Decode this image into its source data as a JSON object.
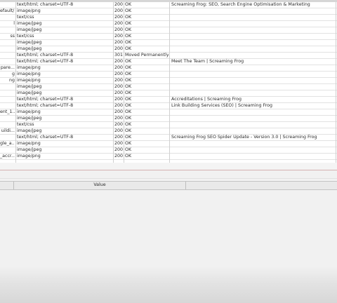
{
  "rows": [
    {
      "address": "",
      "content_type": "text/html; charset=UTF-8",
      "status_code": "200",
      "status": "OK",
      "title": "Screaming Frog: SEO, Search Engine Optimisation & Marketing"
    },
    {
      "address": "efault/...",
      "content_type": "image/png",
      "status_code": "200",
      "status": "OK",
      "title": ""
    },
    {
      "address": "",
      "content_type": "text/css",
      "status_code": "200",
      "status": "OK",
      "title": ""
    },
    {
      "address": "l",
      "content_type": "image/jpeg",
      "status_code": "200",
      "status": "OK",
      "title": ""
    },
    {
      "address": "",
      "content_type": "image/jpeg",
      "status_code": "200",
      "status": "OK",
      "title": ""
    },
    {
      "address": "ss",
      "content_type": "text/css",
      "status_code": "200",
      "status": "OK",
      "title": ""
    },
    {
      "address": "",
      "content_type": "image/jpeg",
      "status_code": "200",
      "status": "OK",
      "title": ""
    },
    {
      "address": "",
      "content_type": "image/jpeg",
      "status_code": "200",
      "status": "OK",
      "title": ""
    },
    {
      "address": "",
      "content_type": "text/html; charset=UTF-8",
      "status_code": "301",
      "status": "Moved Permanently",
      "title": ""
    },
    {
      "address": "",
      "content_type": "text/html; charset=UTF-8",
      "status_code": "200",
      "status": "OK",
      "title": "Meet The Team | Screaming Frog"
    },
    {
      "address": "pare...",
      "content_type": "image/png",
      "status_code": "200",
      "status": "OK",
      "title": ""
    },
    {
      "address": "g",
      "content_type": "image/png",
      "status_code": "200",
      "status": "OK",
      "title": ""
    },
    {
      "address": "ng",
      "content_type": "image/png",
      "status_code": "200",
      "status": "OK",
      "title": ""
    },
    {
      "address": "",
      "content_type": "image/jpeg",
      "status_code": "200",
      "status": "OK",
      "title": ""
    },
    {
      "address": "",
      "content_type": "image/jpeg",
      "status_code": "200",
      "status": "OK",
      "title": ""
    },
    {
      "address": "",
      "content_type": "text/html; charset=UTF-8",
      "status_code": "200",
      "status": "OK",
      "title": "Accreditations | Screaming Frog"
    },
    {
      "address": "",
      "content_type": "text/html; charset=UTF-8",
      "status_code": "200",
      "status": "OK",
      "title": "Link Building Services (SEO) | Screaming Frog"
    },
    {
      "address": "ent_1...",
      "content_type": "image/png",
      "status_code": "200",
      "status": "OK",
      "title": ""
    },
    {
      "address": "",
      "content_type": "image/jpeg",
      "status_code": "200",
      "status": "OK",
      "title": ""
    },
    {
      "address": "",
      "content_type": "text/css",
      "status_code": "200",
      "status": "OK",
      "title": ""
    },
    {
      "address": "uildi...",
      "content_type": "image/jpeg",
      "status_code": "200",
      "status": "OK",
      "title": ""
    },
    {
      "address": "",
      "content_type": "text/html; charset=UTF-8",
      "status_code": "200",
      "status": "OK",
      "title": "Screaming Frog SEO Spider Update - Version 3.0 | Screaming Frog"
    },
    {
      "address": "gle_a...",
      "content_type": "image/png",
      "status_code": "200",
      "status": "OK",
      "title": ""
    },
    {
      "address": "",
      "content_type": "image/jpeg",
      "status_code": "200",
      "status": "OK",
      "title": ""
    },
    {
      "address": "_accr...",
      "content_type": "image/png",
      "status_code": "200",
      "status": "OK",
      "title": ""
    }
  ],
  "details": {
    "value_header": "Value"
  }
}
